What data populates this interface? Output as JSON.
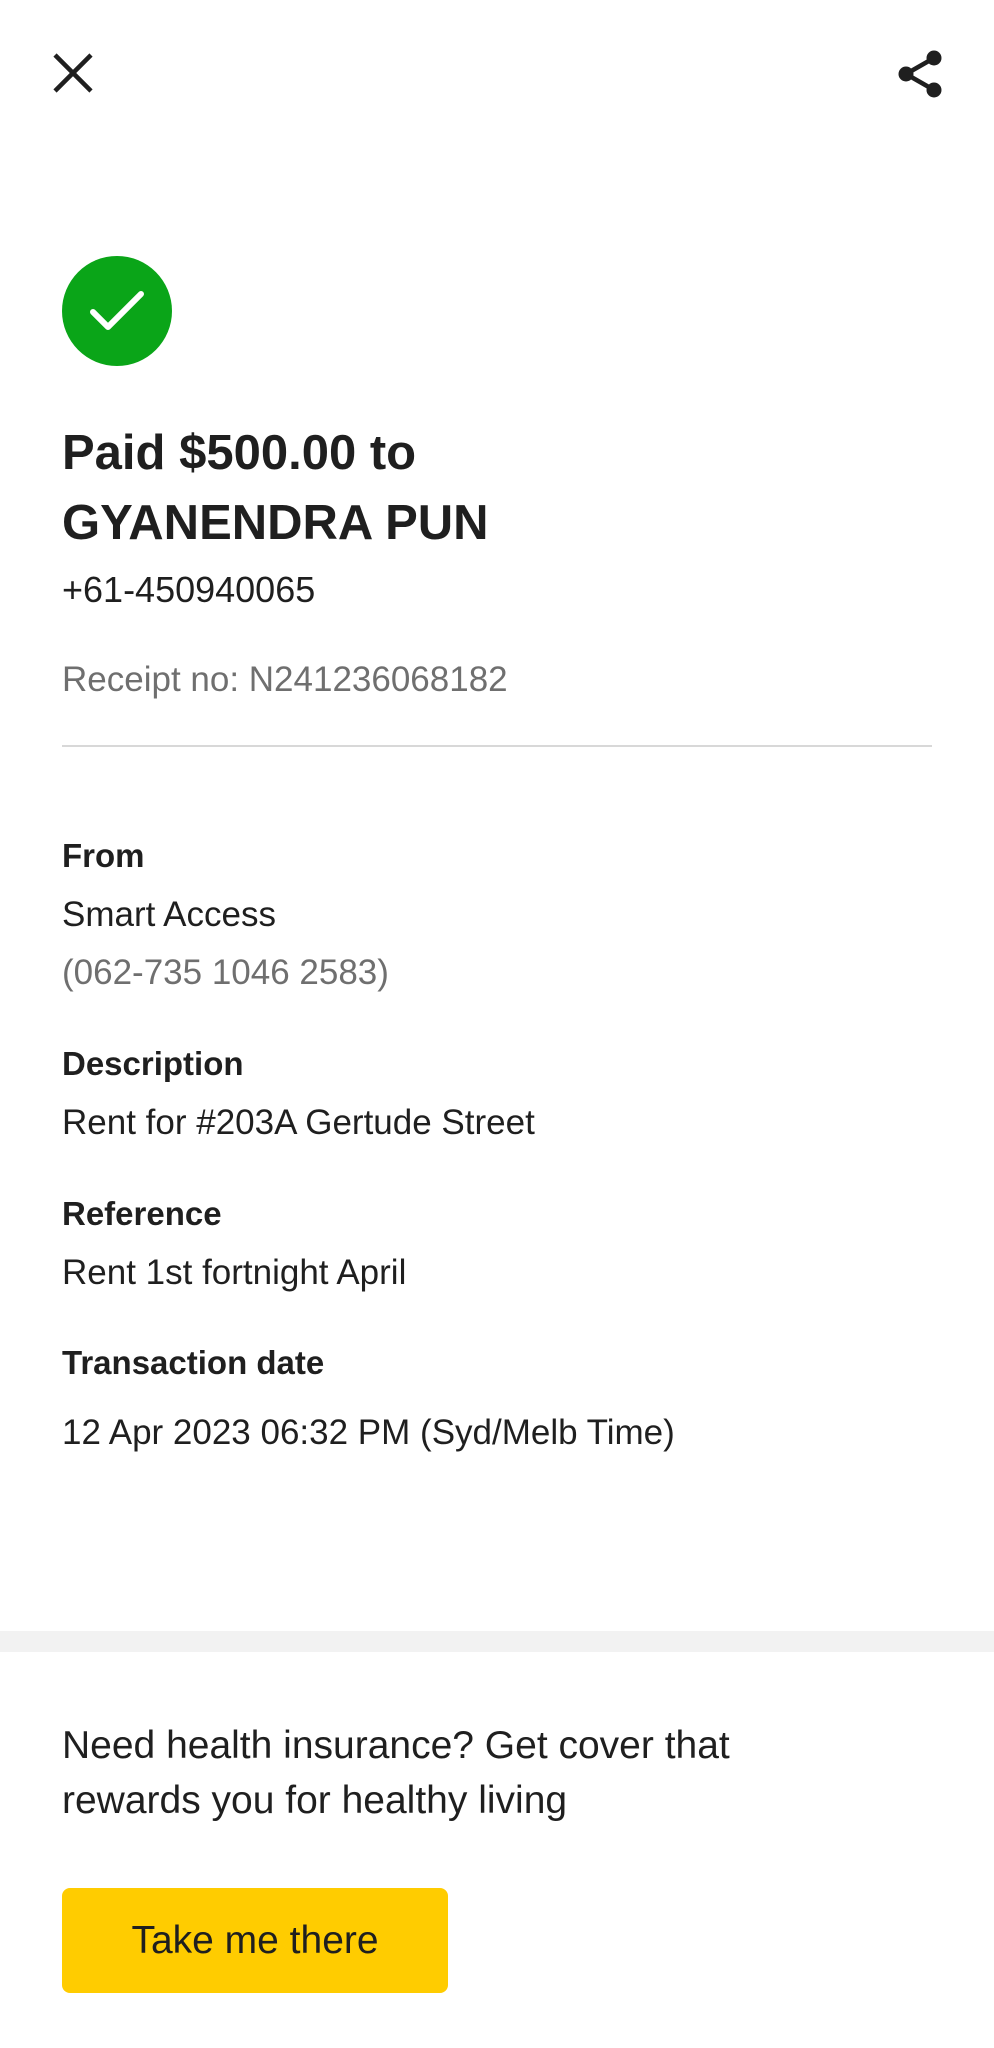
{
  "header": {
    "close_icon": "close-icon",
    "share_icon": "share-icon"
  },
  "status": {
    "icon": "check-icon",
    "color": "#0aa518"
  },
  "payment": {
    "headline_line1": "Paid $500.00 to",
    "headline_line2": "GYANENDRA PUN",
    "phone": "+61-450940065",
    "receipt": "Receipt no: N241236068182"
  },
  "details": {
    "from_label": "From",
    "from_account_name": "Smart Access",
    "from_account_number": "(062-735 1046 2583)",
    "description_label": "Description",
    "description_value": "Rent for #203A Gertude Street",
    "reference_label": "Reference",
    "reference_value": "Rent 1st fortnight April",
    "date_label": "Transaction date",
    "date_value": "12 Apr 2023 06:32 PM (Syd/Melb Time)"
  },
  "promo": {
    "text_line1": "Need health insurance? Get cover that",
    "text_line2": "rewards you for healthy living",
    "button_label": "Take me there",
    "button_color": "#ffcc00"
  }
}
